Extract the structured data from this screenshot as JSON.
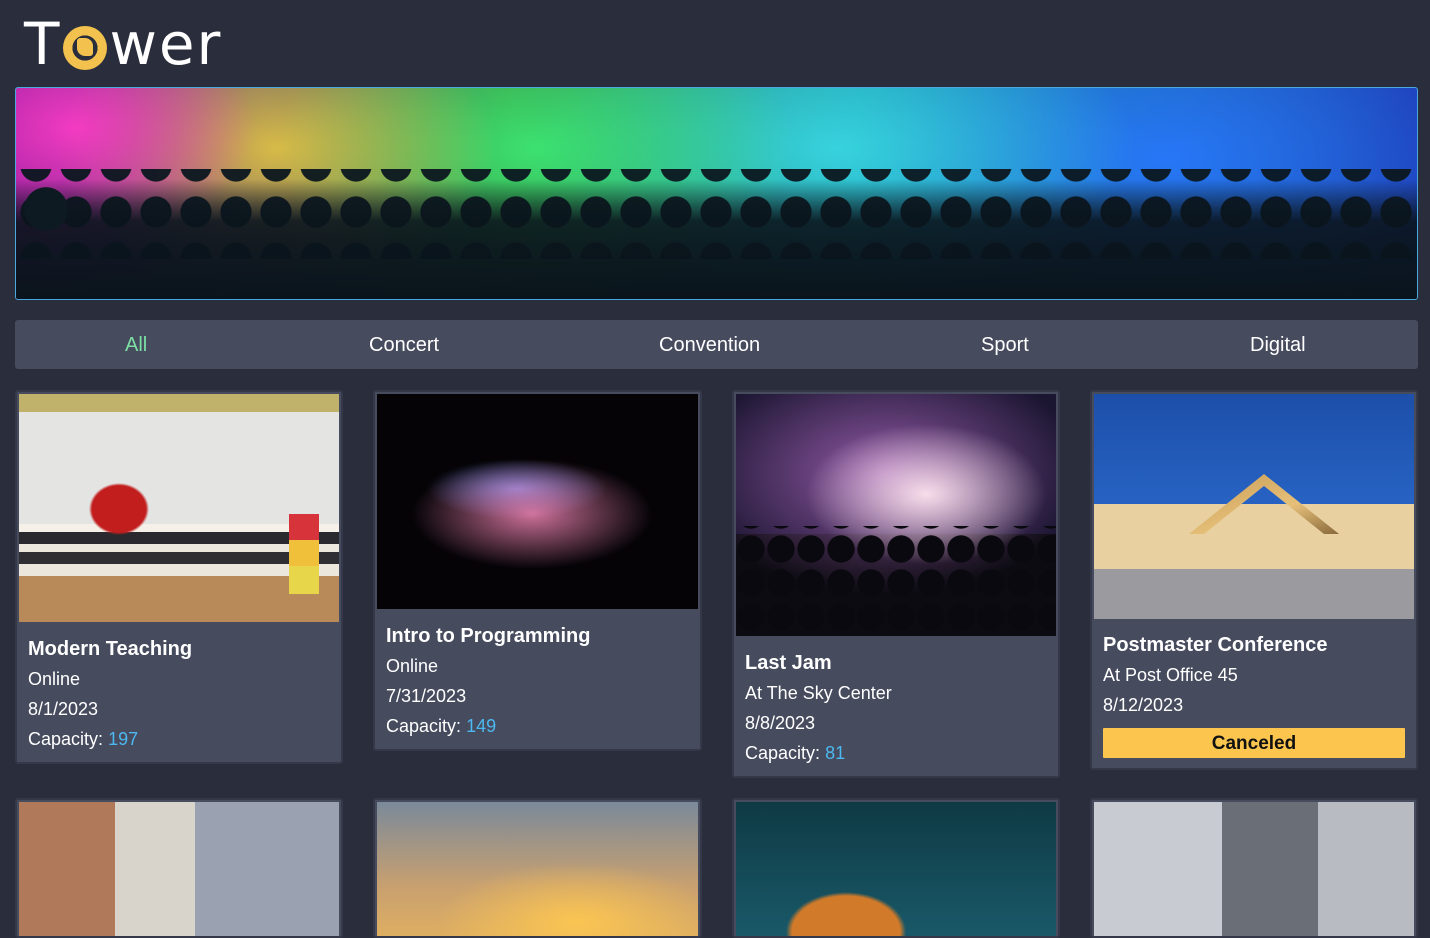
{
  "app": {
    "logo_text_before": "T",
    "logo_text_after": "wer"
  },
  "categories": [
    {
      "label": "All",
      "active": true
    },
    {
      "label": "Concert",
      "active": false
    },
    {
      "label": "Convention",
      "active": false
    },
    {
      "label": "Sport",
      "active": false
    },
    {
      "label": "Digital",
      "active": false
    }
  ],
  "events": [
    {
      "title": "Modern Teaching",
      "location": "Online",
      "date": "8/1/2023",
      "capacity_label": "Capacity:",
      "capacity": "197"
    },
    {
      "title": "Intro to Programming",
      "location": "Online",
      "date": "7/31/2023",
      "capacity_label": "Capacity:",
      "capacity": "149"
    },
    {
      "title": "Last Jam",
      "location": "At The Sky Center",
      "date": "8/8/2023",
      "capacity_label": "Capacity:",
      "capacity": "81"
    },
    {
      "title": "Postmaster Conference",
      "location": "At Post Office 45",
      "date": "8/12/2023",
      "status": "Canceled"
    }
  ],
  "colors": {
    "background": "#2a2d3b",
    "card": "#474b5e",
    "active_category": "#7be0a4",
    "capacity_value": "#4cb8f0",
    "canceled_badge": "#fbc54e",
    "banner_border": "#4aa8e0"
  }
}
